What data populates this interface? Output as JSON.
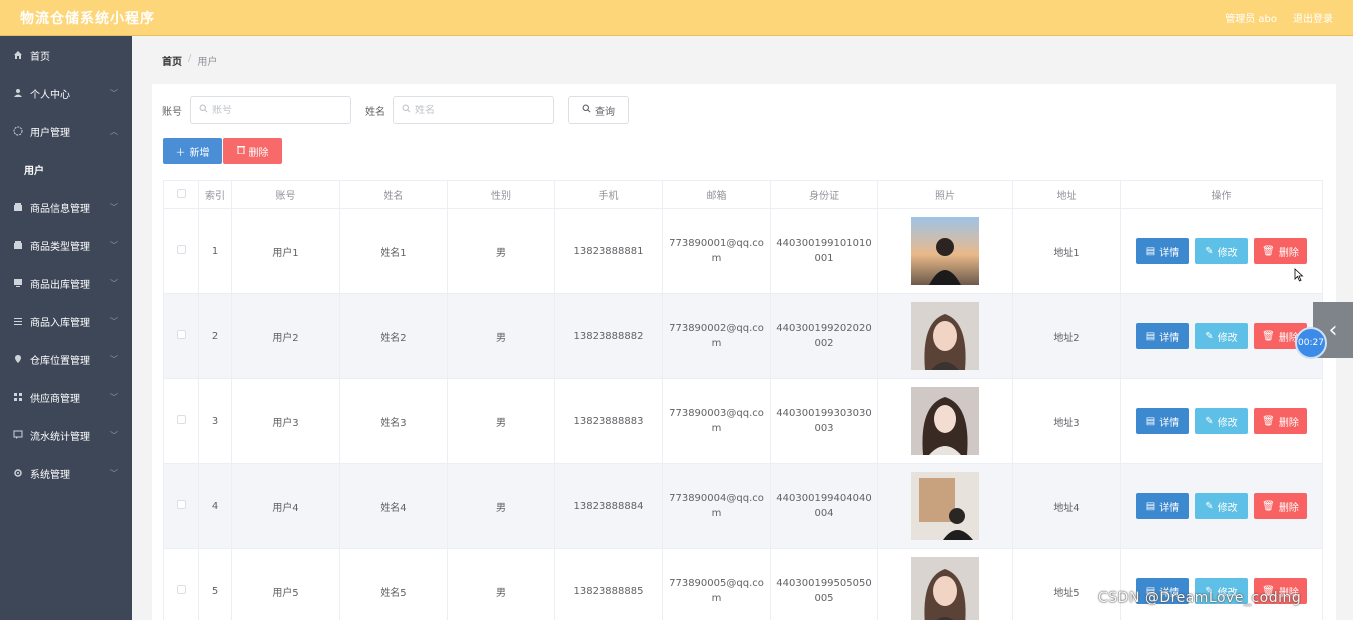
{
  "app": {
    "title": "物流仓储系统小程序",
    "admin_label": "管理员 abo",
    "logout_label": "退出登录"
  },
  "sidebar": {
    "items": [
      {
        "label": "首页",
        "icon": "home-icon",
        "has_children": false
      },
      {
        "label": "个人中心",
        "icon": "user-icon",
        "has_children": true
      },
      {
        "label": "用户管理",
        "icon": "globe-icon",
        "has_children": true,
        "expanded": true
      },
      {
        "label": "商品信息管理",
        "icon": "box-icon",
        "has_children": true
      },
      {
        "label": "商品类型管理",
        "icon": "box-icon",
        "has_children": true
      },
      {
        "label": "商品出库管理",
        "icon": "monitor-icon",
        "has_children": true
      },
      {
        "label": "商品入库管理",
        "icon": "list-icon",
        "has_children": true
      },
      {
        "label": "仓库位置管理",
        "icon": "location-icon",
        "has_children": true
      },
      {
        "label": "供应商管理",
        "icon": "grid-icon",
        "has_children": true
      },
      {
        "label": "流水统计管理",
        "icon": "chat-icon",
        "has_children": true
      },
      {
        "label": "系统管理",
        "icon": "settings-icon",
        "has_children": true
      }
    ],
    "sub_item": "用户"
  },
  "breadcrumb": {
    "home": "首页",
    "separator": "/",
    "current": "用户"
  },
  "search": {
    "account_label": "账号",
    "account_placeholder": "账号",
    "name_label": "姓名",
    "name_placeholder": "姓名",
    "query_label": "查询"
  },
  "toolbar": {
    "add_label": "新增",
    "delete_label": "删除"
  },
  "table": {
    "columns": [
      "索引",
      "账号",
      "姓名",
      "性别",
      "手机",
      "邮箱",
      "身份证",
      "照片",
      "地址",
      "操作"
    ],
    "rows": [
      {
        "index": "1",
        "account": "用户1",
        "name": "姓名1",
        "gender": "男",
        "phone": "13823888881",
        "email": "773890001@qq.com",
        "id_card": "440300199101010001",
        "address": "地址1"
      },
      {
        "index": "2",
        "account": "用户2",
        "name": "姓名2",
        "gender": "男",
        "phone": "13823888882",
        "email": "773890002@qq.com",
        "id_card": "440300199202020002",
        "address": "地址2"
      },
      {
        "index": "3",
        "account": "用户3",
        "name": "姓名3",
        "gender": "男",
        "phone": "13823888883",
        "email": "773890003@qq.com",
        "id_card": "440300199303030003",
        "address": "地址3"
      },
      {
        "index": "4",
        "account": "用户4",
        "name": "姓名4",
        "gender": "男",
        "phone": "13823888884",
        "email": "773890004@qq.com",
        "id_card": "440300199404040004",
        "address": "地址4"
      },
      {
        "index": "5",
        "account": "用户5",
        "name": "姓名5",
        "gender": "男",
        "phone": "13823888885",
        "email": "773890005@qq.com",
        "id_card": "440300199505050005",
        "address": "地址5"
      }
    ],
    "row_actions": {
      "detail": "详情",
      "edit": "修改",
      "remove": "删除"
    }
  },
  "overlay": {
    "timer": "00:27",
    "watermark": "CSDN @DreamLove_coding"
  },
  "colors": {
    "topbar": "#fdd67a",
    "sidebar": "#3e4758",
    "primary": "#4a8fd6",
    "danger": "#f86a6a",
    "info": "#5ec0e6"
  }
}
